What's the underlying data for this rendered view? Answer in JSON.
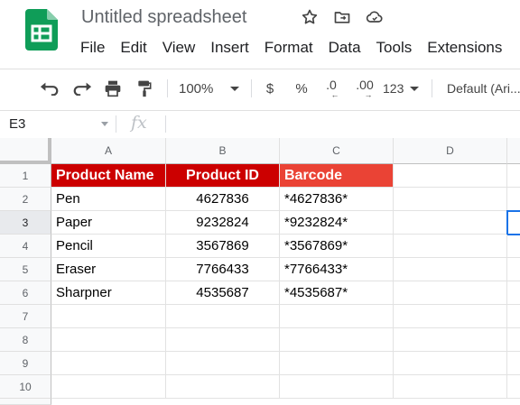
{
  "doc": {
    "title": "Untitled spreadsheet"
  },
  "menu": [
    "File",
    "Edit",
    "View",
    "Insert",
    "Format",
    "Data",
    "Tools",
    "Extensions"
  ],
  "toolbar": {
    "zoom": "100%",
    "currency": "$",
    "percent": "%",
    "dec_decrease": ".0",
    "dec_increase": ".00",
    "more_formats": "123",
    "font": "Default (Ari..."
  },
  "formula_bar": {
    "name_box": "E3",
    "fx": "fx",
    "value": ""
  },
  "sheet": {
    "columns": [
      "A",
      "B",
      "C",
      "D"
    ],
    "rows": [
      "1",
      "2",
      "3",
      "4",
      "5",
      "6",
      "7",
      "8",
      "9",
      "10"
    ],
    "header": [
      "Product Name",
      "Product ID",
      "Barcode"
    ],
    "data": [
      [
        "Pen",
        "4627836",
        "*4627836*"
      ],
      [
        "Paper",
        "9232824",
        "*9232824*"
      ],
      [
        "Pencil",
        "3567869",
        "*3567869*"
      ],
      [
        "Eraser",
        "7766433",
        "*7766433*"
      ],
      [
        "Sharpner",
        "4535687",
        "*4535687*"
      ]
    ],
    "selected_cell": "E3"
  },
  "colors": {
    "header_red": "#cc0000",
    "header_barcode": "#ea4335",
    "selection": "#1a73e8",
    "logo_green": "#0f9d58"
  }
}
